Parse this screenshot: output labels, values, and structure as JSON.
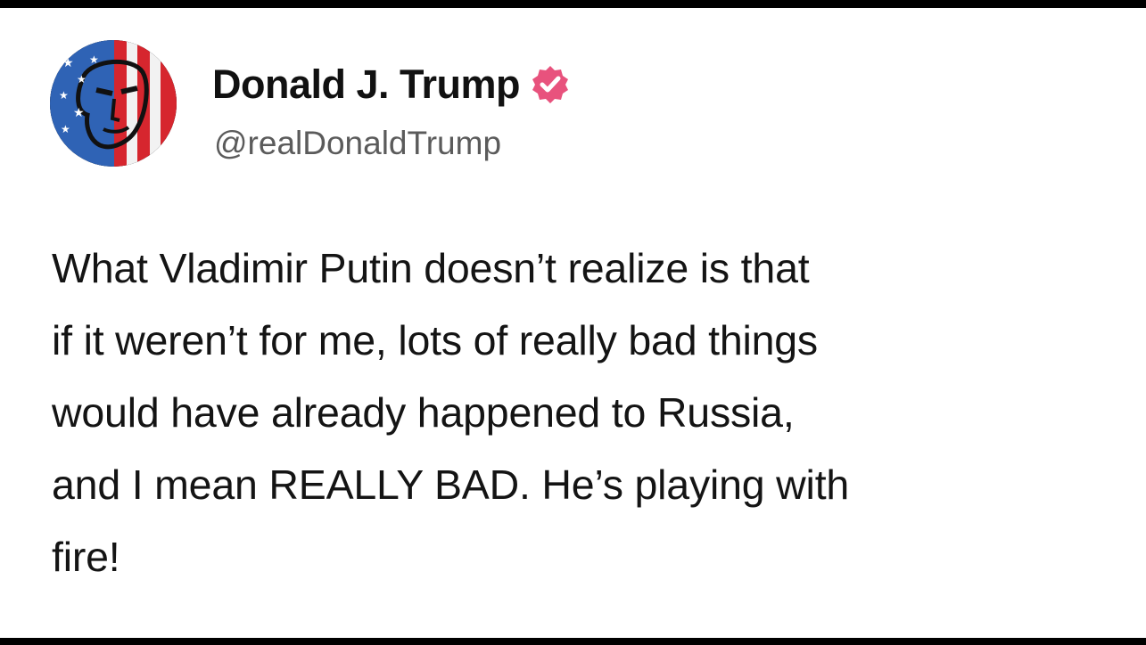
{
  "author": {
    "name": "Donald J. Trump",
    "handle": "@realDonaldTrump",
    "avatar_icon": "flag-portrait-avatar",
    "verified_icon": "verified-badge-icon",
    "verified_color": "#E8527D"
  },
  "post": {
    "lines": [
      "What Vladimir Putin doesn’t realize is that",
      "if it weren’t for me, lots of really bad things",
      "would have already happened to Russia,",
      "and I mean REALLY BAD. He’s playing with",
      "fire!"
    ]
  },
  "colors": {
    "frame": "#000000",
    "background": "#ffffff",
    "text": "#141414",
    "handle": "#5b5b5b"
  }
}
